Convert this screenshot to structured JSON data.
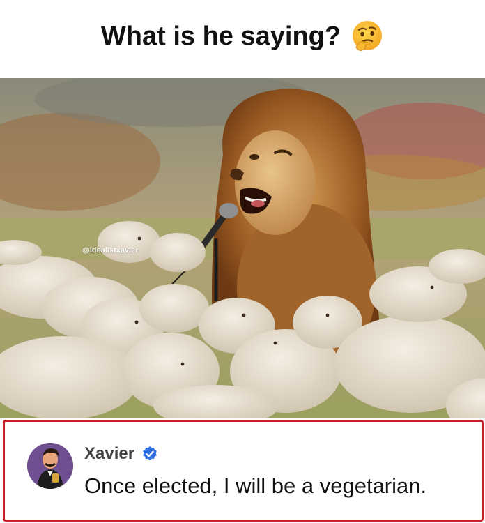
{
  "header": {
    "title": "What is he saying?",
    "emoji": "thinking-face-emoji"
  },
  "image": {
    "watermark": "@idealistxavier",
    "scene": "lion-speaking-into-microphone-to-sheep"
  },
  "comment": {
    "author": "Xavier",
    "verified": true,
    "text": "Once elected, I will be a vegetarian.",
    "border_color": "#c8202a",
    "verified_color": "#2f6fdf"
  },
  "colors": {
    "accent_border": "#c8202a",
    "avatar_bg": "#6e4f8f"
  }
}
